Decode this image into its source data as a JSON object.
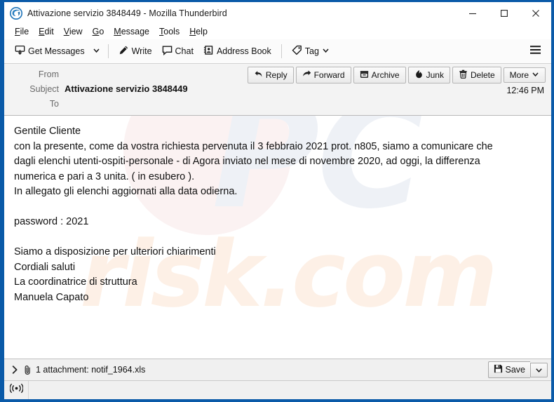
{
  "window": {
    "title": "Attivazione servizio 3848449 - Mozilla Thunderbird",
    "app_icon": "thunderbird-icon",
    "controls": {
      "minimize": "–",
      "maximize": "□",
      "close": "✕"
    },
    "border_color": "#0a5aa8"
  },
  "menubar": {
    "items": [
      {
        "label": "File",
        "accel": "F",
        "rest": "ile"
      },
      {
        "label": "Edit",
        "accel": "E",
        "rest": "dit"
      },
      {
        "label": "View",
        "accel": "V",
        "rest": "iew"
      },
      {
        "label": "Go",
        "accel": "G",
        "rest": "o"
      },
      {
        "label": "Message",
        "accel": "M",
        "rest": "essage"
      },
      {
        "label": "Tools",
        "accel": "T",
        "rest": "ools"
      },
      {
        "label": "Help",
        "accel": "H",
        "rest": "elp"
      }
    ]
  },
  "toolbar": {
    "get_messages": "Get Messages",
    "get_messages_caret": "⌄",
    "write": "Write",
    "chat": "Chat",
    "address_book": "Address Book",
    "tag": "Tag",
    "tag_caret": "⌄",
    "app_menu": "app-menu"
  },
  "message_header": {
    "from_label": "From",
    "from_value": "",
    "subject_label": "Subject",
    "subject_value": "Attivazione servizio 3848449",
    "to_label": "To",
    "to_value": "",
    "date": "12:46 PM",
    "actions": [
      {
        "label": "Reply",
        "icon": "reply-icon"
      },
      {
        "label": "Forward",
        "icon": "forward-icon"
      },
      {
        "label": "Archive",
        "icon": "archive-icon"
      },
      {
        "label": "Junk",
        "icon": "junk-icon"
      },
      {
        "label": "Delete",
        "icon": "trash-icon"
      },
      {
        "label": "More",
        "icon": "chevron-down-icon"
      }
    ]
  },
  "body": {
    "text": "Gentile Cliente\ncon la presente, come da vostra richiesta pervenuta il 3 febbraio 2021 prot. n805, siamo a comunicare che\ndagli elenchi utenti-ospiti-personale - di Agora inviato nel mese di novembre 2020, ad oggi, la differenza\nnumerica e pari a 3 unita. ( in esubero ).\nIn allegato gli elenchi aggiornati alla data odierna.\n\npassword : 2021\n\nSiamo a disposizione per ulteriori chiarimenti\nCordiali saluti\nLa coordinatrice di struttura\nManuela Capato",
    "watermark_primary": "PC",
    "watermark_secondary": "risk.com"
  },
  "attachment_bar": {
    "twisty": "›",
    "clip_icon": "paperclip-icon",
    "label": "1 attachment: notif_1964.xls",
    "save_label": "Save",
    "save_caret": "⌄"
  },
  "status_bar": {
    "online_icon": "broadcast-icon",
    "text": ""
  }
}
